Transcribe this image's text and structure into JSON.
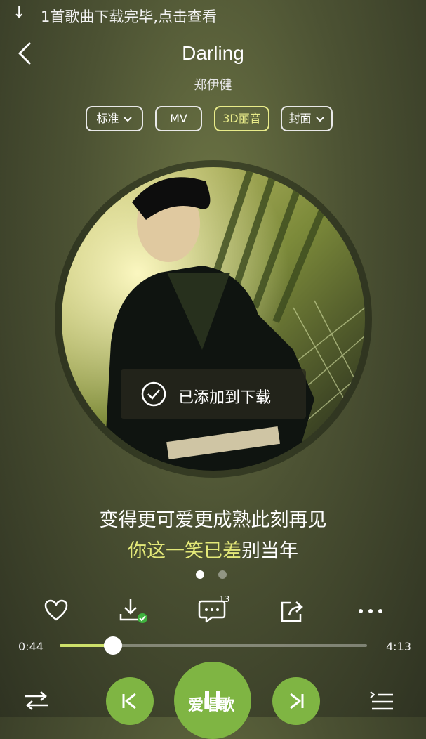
{
  "notification": {
    "text": "1首歌曲下载完毕,点击查看"
  },
  "song": {
    "title": "Darling",
    "artist": "郑伊健"
  },
  "options": {
    "quality": "标准",
    "mv": "MV",
    "sound": "3D丽音",
    "cover": "封面"
  },
  "toast": {
    "text": "已添加到下载"
  },
  "lyrics": {
    "line1": "变得更可爱更成熟此刻再见",
    "line2_sung": "你这一笑已差",
    "line2_rest": "别当年"
  },
  "pager": {
    "count": 2,
    "active": 1
  },
  "actions": {
    "comment_count": "13"
  },
  "progress": {
    "current": "0:44",
    "total": "4:13",
    "fraction": 0.174
  },
  "watermark": "爱唱歌",
  "colors": {
    "accent": "#7fb543",
    "lyric_highlight": "#e3e878",
    "active_pill": "#e9ec8a"
  }
}
